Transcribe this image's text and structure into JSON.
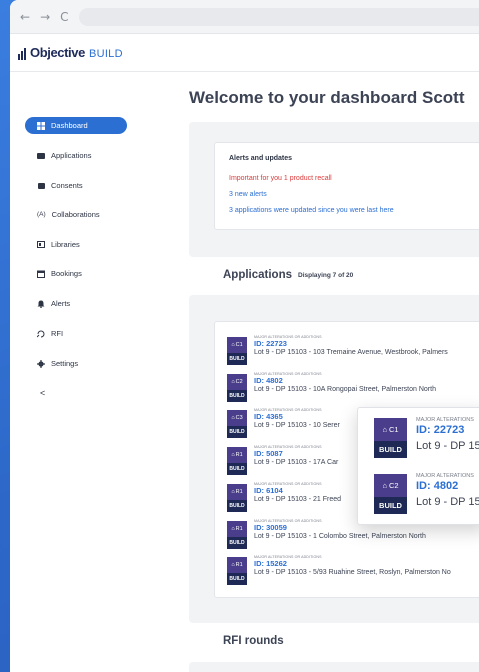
{
  "browser": {
    "back_icon": "←",
    "forward_icon": "→",
    "reload_icon": "C"
  },
  "app": {
    "logo_name": "Objective",
    "logo_sub": "BUILD"
  },
  "sidebar": {
    "items": [
      {
        "label": "Dashboard",
        "icon": "dashboard-icon",
        "active": true
      },
      {
        "label": "Applications",
        "icon": "applications-icon"
      },
      {
        "label": "Consents",
        "icon": "consents-icon"
      },
      {
        "label": "Collaborations",
        "icon": "collaborations-icon",
        "glyph": "(A)"
      },
      {
        "label": "Libraries",
        "icon": "libraries-icon"
      },
      {
        "label": "Bookings",
        "icon": "bookings-icon"
      },
      {
        "label": "Alerts",
        "icon": "bell-icon"
      },
      {
        "label": "RFI",
        "icon": "rfi-icon"
      },
      {
        "label": "Settings",
        "icon": "gear-icon"
      }
    ],
    "collapse_glyph": "<"
  },
  "main": {
    "welcome": "Welcome to your dashboard Scott",
    "alerts": {
      "title": "Alerts and updates",
      "important": "Important for you 1 product recall",
      "new_alerts": "3 new alerts",
      "updated": "3 applications were updated since you were last here"
    },
    "applications": {
      "title": "Applications",
      "displaying": "Displaying  7 of 20",
      "rows": [
        {
          "badge": "C1",
          "badge_bottom": "BUILD",
          "type": "MAJOR ALTERATIONS OR ADDITIONS",
          "id": "ID: 22723",
          "address": "Lot 9 - DP 15103 - 103 Tremaine Avenue, Westbrook, Palmers"
        },
        {
          "badge": "C2",
          "badge_bottom": "BUILD",
          "type": "MAJOR ALTERATIONS OR ADDITIONS",
          "id": "ID: 4802",
          "address": "Lot 9 - DP 15103 - 10A Rongopai Street, Palmerston North"
        },
        {
          "badge": "C3",
          "badge_bottom": "BUILD",
          "type": "MAJOR ALTERATIONS OR ADDITIONS",
          "id": "ID: 4365",
          "address": "Lot 9 - DP 15103 - 10 Serer"
        },
        {
          "badge": "R1",
          "badge_bottom": "BUILD",
          "type": "MAJOR ALTERATIONS OR ADDITIONS",
          "id": "ID: 5087",
          "address": "Lot 9 - DP 15103 - 17A Car"
        },
        {
          "badge": "R1",
          "badge_bottom": "BUILD",
          "type": "MAJOR ALTERATIONS OR ADDITIONS",
          "id": "ID: 6104",
          "address": "Lot 9 - DP 15103 - 21 Freed"
        },
        {
          "badge": "R1",
          "badge_bottom": "BUILD",
          "type": "MAJOR ALTERATIONS OR ADDITIONS",
          "id": "ID: 30059",
          "address": "Lot 9 - DP 15103 - 1 Colombo Street, Palmerston North"
        },
        {
          "badge": "R1",
          "badge_bottom": "BUILD",
          "type": "MAJOR ALTERATIONS OR ADDITIONS",
          "id": "ID: 15262",
          "address": "Lot 9 - DP 15103 - 5/93 Ruahine Street, Roslyn, Palmerston No"
        }
      ]
    },
    "popup": {
      "rows": [
        {
          "badge": "C1",
          "badge_bottom": "BUILD",
          "type": "MAJOR ALTERATIONS",
          "id": "ID: 22723",
          "address": "Lot 9 - DP 15"
        },
        {
          "badge": "C2",
          "badge_bottom": "BUILD",
          "type": "MAJOR ALTERATIONS",
          "id": "ID: 4802",
          "address": "Lot 9 - DP 15"
        }
      ]
    },
    "rfi": {
      "title": "RFI rounds"
    }
  }
}
